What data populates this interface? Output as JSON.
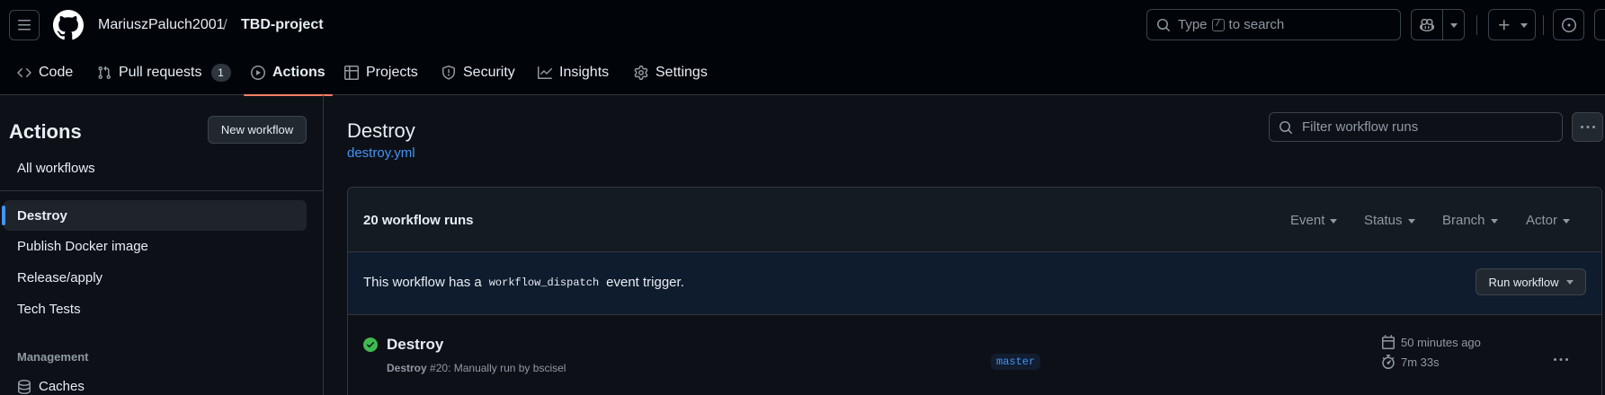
{
  "header": {
    "owner": "MariuszPaluch2001",
    "separator": "/",
    "repo": "TBD-project",
    "search": {
      "prefix": "Type",
      "key": "/",
      "suffix": "to search"
    }
  },
  "tabs": [
    {
      "label": "Code",
      "icon": "code-icon"
    },
    {
      "label": "Pull requests",
      "icon": "git-pull-request-icon",
      "count": "1"
    },
    {
      "label": "Actions",
      "icon": "play-icon",
      "active": true
    },
    {
      "label": "Projects",
      "icon": "table-icon"
    },
    {
      "label": "Security",
      "icon": "shield-icon"
    },
    {
      "label": "Insights",
      "icon": "graph-icon"
    },
    {
      "label": "Settings",
      "icon": "gear-icon"
    }
  ],
  "sidebar": {
    "title": "Actions",
    "new_workflow": "New workflow",
    "all_workflows": "All workflows",
    "workflows": [
      {
        "label": "Destroy",
        "selected": true
      },
      {
        "label": "Publish Docker image"
      },
      {
        "label": "Release/apply"
      },
      {
        "label": "Tech Tests"
      }
    ],
    "management_label": "Management",
    "caches": "Caches"
  },
  "main": {
    "title": "Destroy",
    "file": "destroy.yml",
    "filter_placeholder": "Filter workflow runs",
    "runs_count": "20 workflow runs",
    "filters": [
      "Event",
      "Status",
      "Branch",
      "Actor"
    ],
    "dispatch": {
      "prefix": "This workflow has a",
      "code": "workflow_dispatch",
      "suffix": "event trigger."
    },
    "run_workflow": "Run workflow",
    "run": {
      "title": "Destroy",
      "workflow_name": "Destroy",
      "detail": "#20: Manually run by bscisel",
      "branch": "master",
      "time_ago": "50 minutes ago",
      "duration": "7m 33s",
      "status": "success"
    }
  },
  "colors": {
    "accent": "#4493f8",
    "active_tab_underline": "#f78166",
    "success": "#3fb950",
    "background": "#0d1117"
  }
}
